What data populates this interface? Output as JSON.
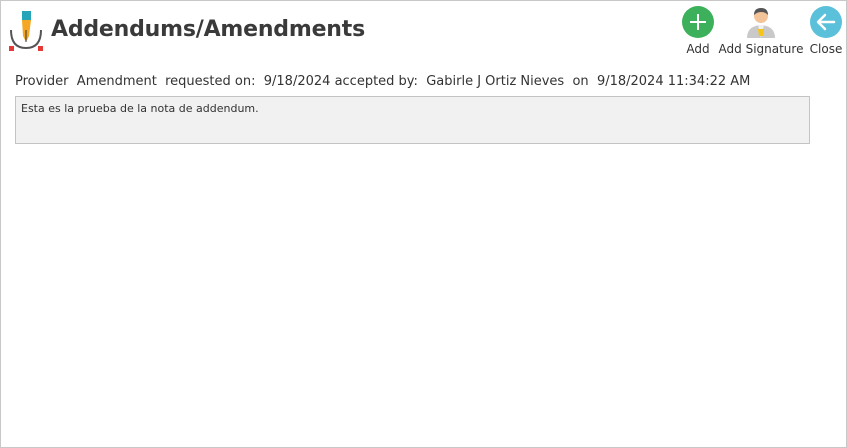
{
  "window": {
    "title": "Addendums/Amendments"
  },
  "toolbar": {
    "add_label": "Add",
    "add_signature_label": "Add Signature",
    "close_label": "Close"
  },
  "amendment": {
    "type": "Provider",
    "kind": "Amendment",
    "requested_label": "requested on:",
    "requested_date": "9/18/2024",
    "accepted_label": "accepted by:",
    "accepted_by": "Gabirle J Ortiz Nieves",
    "on_label": "on",
    "accepted_datetime": "9/18/2024 11:34:22 AM",
    "note_text": "Esta es la prueba de la nota de addendum."
  },
  "colors": {
    "add_button": "#3cb05a",
    "close_button": "#5bc0d9",
    "title_text": "#3a3a3a"
  },
  "icons": {
    "app": "pen-nib-icon",
    "add": "plus-circle-icon",
    "add_signature": "user-signature-icon",
    "close": "arrow-left-circle-icon"
  }
}
